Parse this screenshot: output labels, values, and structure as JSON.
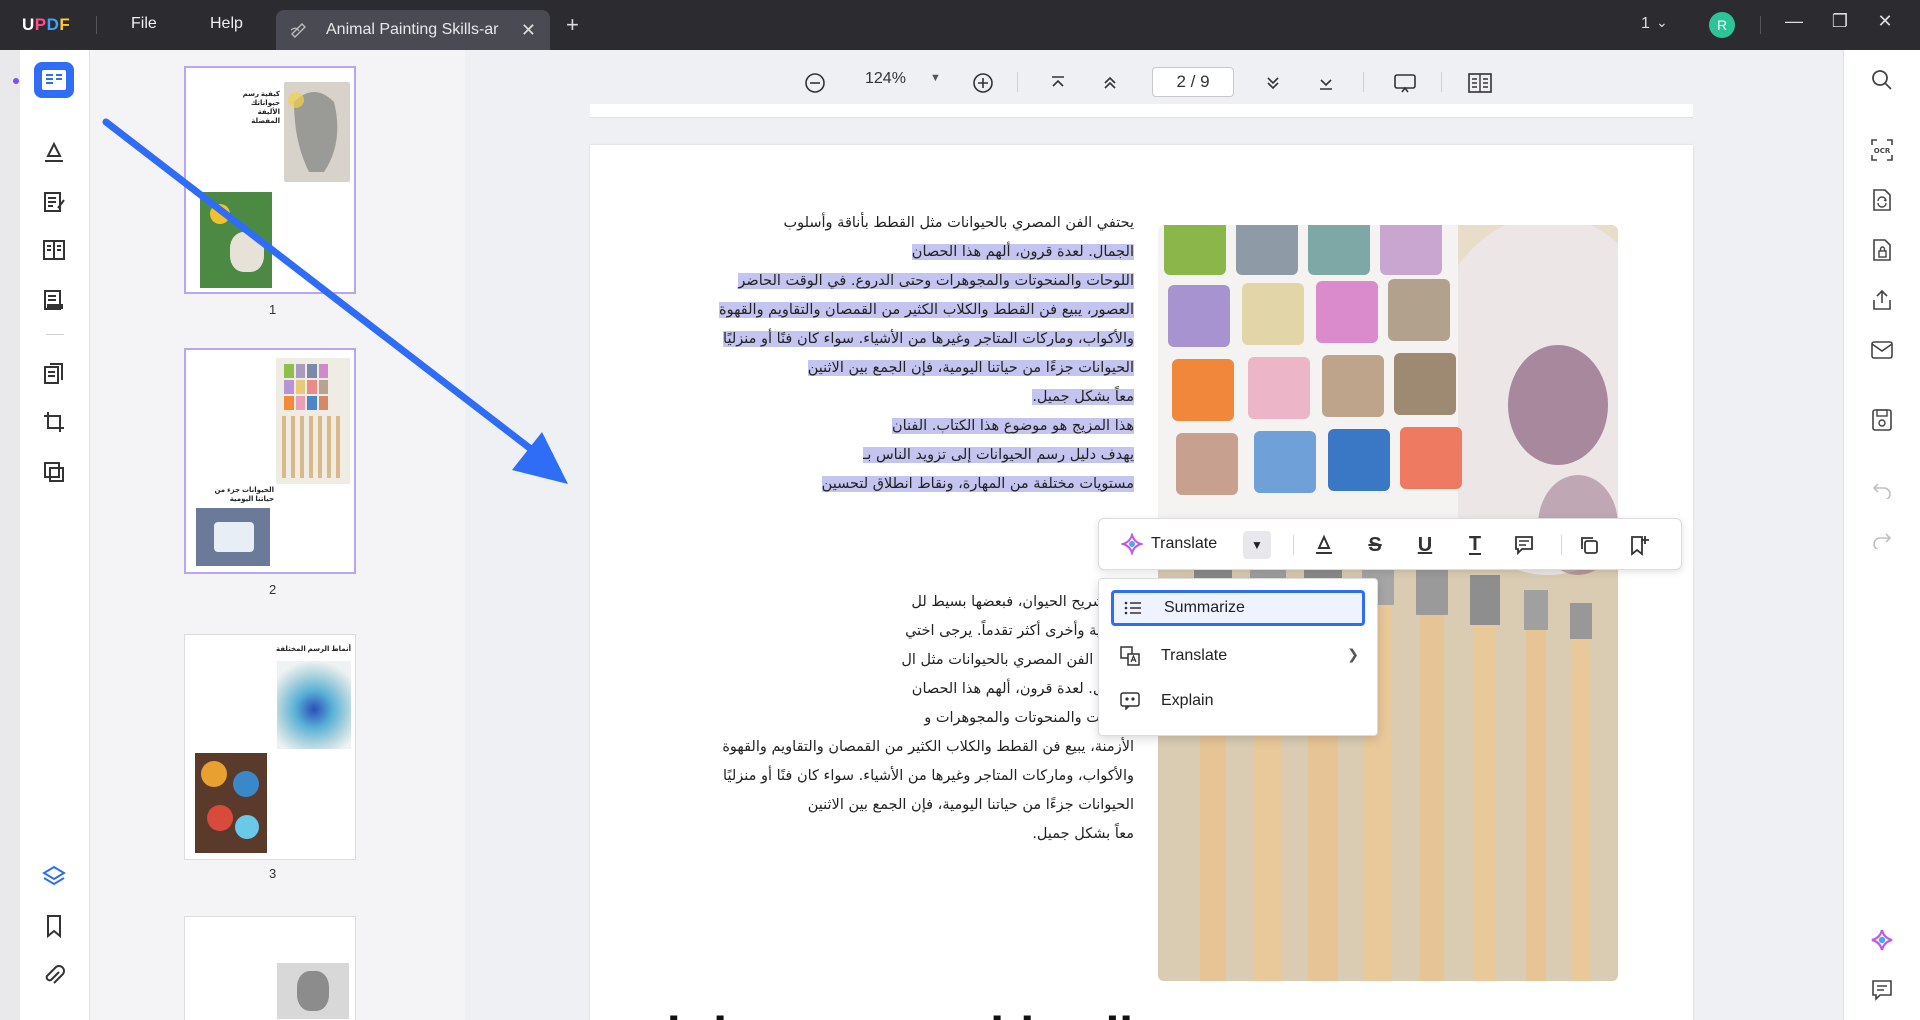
{
  "app": {
    "logo": "UPDF",
    "menu": [
      "File",
      "Help"
    ],
    "tab_title": "Animal Painting Skills-ar",
    "window_count": "1",
    "user_initial": "R"
  },
  "viewer": {
    "zoom": "124%",
    "page_indicator": "2 / 9"
  },
  "thumbnails": [
    {
      "number": "1",
      "title": "كيفية رسم حيواناتك الأليفة المفضلة"
    },
    {
      "number": "2",
      "title": "الحيوانات جزء من حياتنا اليومية"
    },
    {
      "number": "3",
      "title": "أنماط الرسم المختلفة"
    }
  ],
  "document": {
    "lines_top": [
      {
        "text": "يحتفي الفن المصري بالحيوانات مثل القطط بأناقة وأسلوب",
        "highlighted": false
      },
      {
        "text": "الجمال. لعدة قرون، ألهم هذا الحصان",
        "highlighted": true
      },
      {
        "text": "اللوحات والمنحوتات والمجوهرات وحتى الدروع. في الوقت الحاضر",
        "highlighted": true
      },
      {
        "text": "العصور، يبيع فن القطط والكلاب الكثير من القمصان والتقاويم والقهوة",
        "highlighted": true
      },
      {
        "text": "والأكواب، وماركات المتاجر وغيرها من الأشياء. سواء كان فنًا أو منزليًا",
        "highlighted": true
      },
      {
        "text": "الحيوانات جزءًا من حياتنا اليومية، فإن الجمع بين الاثنين",
        "highlighted": true
      },
      {
        "text": "معاً بشكل جميل.",
        "highlighted": true
      },
      {
        "text": "هذا المزيج هو موضوع هذا الكتاب. الفنان",
        "highlighted": true
      },
      {
        "text": "يهدف دليل رسم الحيوانات إلى تزويد الناس بـ",
        "highlighted": true
      },
      {
        "text": "مستويات مختلفة من المهارة، ونقاط انطلاق لتحسين",
        "highlighted": true
      }
    ],
    "lines_bottom": [
      "بناء تشريح الحيوان، فبعضها بسيط لل",
      "أساسية وأخرى أكثر تقدماً. يرجى اختي",
      "يحتفل الفن المصري بالحيوانات مثل ال",
      "الجمال. لعدة قرون، ألهم هذا الحصان",
      "اللوحات والمنحوتات والمجوهرات و",
      "الأزمنة، يبيع فن القطط والكلاب الكثير من القمصان والتقاويم والقهوة",
      "والأكواب، وماركات المتاجر وغيرها من الأشياء. سواء كان فنًا أو منزليًا",
      "الحيوانات جزءًا من حياتنا اليومية، فإن الجمع بين الاثنين",
      "معاً بشكل جميل."
    ],
    "heading_cut": "الحيوانات جزء من حياتنا"
  },
  "floating_toolbar": {
    "translate_label": "Translate"
  },
  "dropdown": {
    "items": [
      {
        "label": "Summarize",
        "icon": "list-icon"
      },
      {
        "label": "Translate",
        "icon": "translate-icon"
      },
      {
        "label": "Explain",
        "icon": "explain-icon"
      }
    ]
  },
  "colors": {
    "accent": "#2f6df6",
    "highlight": "#c4c4f0",
    "titlebar": "#2b2b30"
  }
}
